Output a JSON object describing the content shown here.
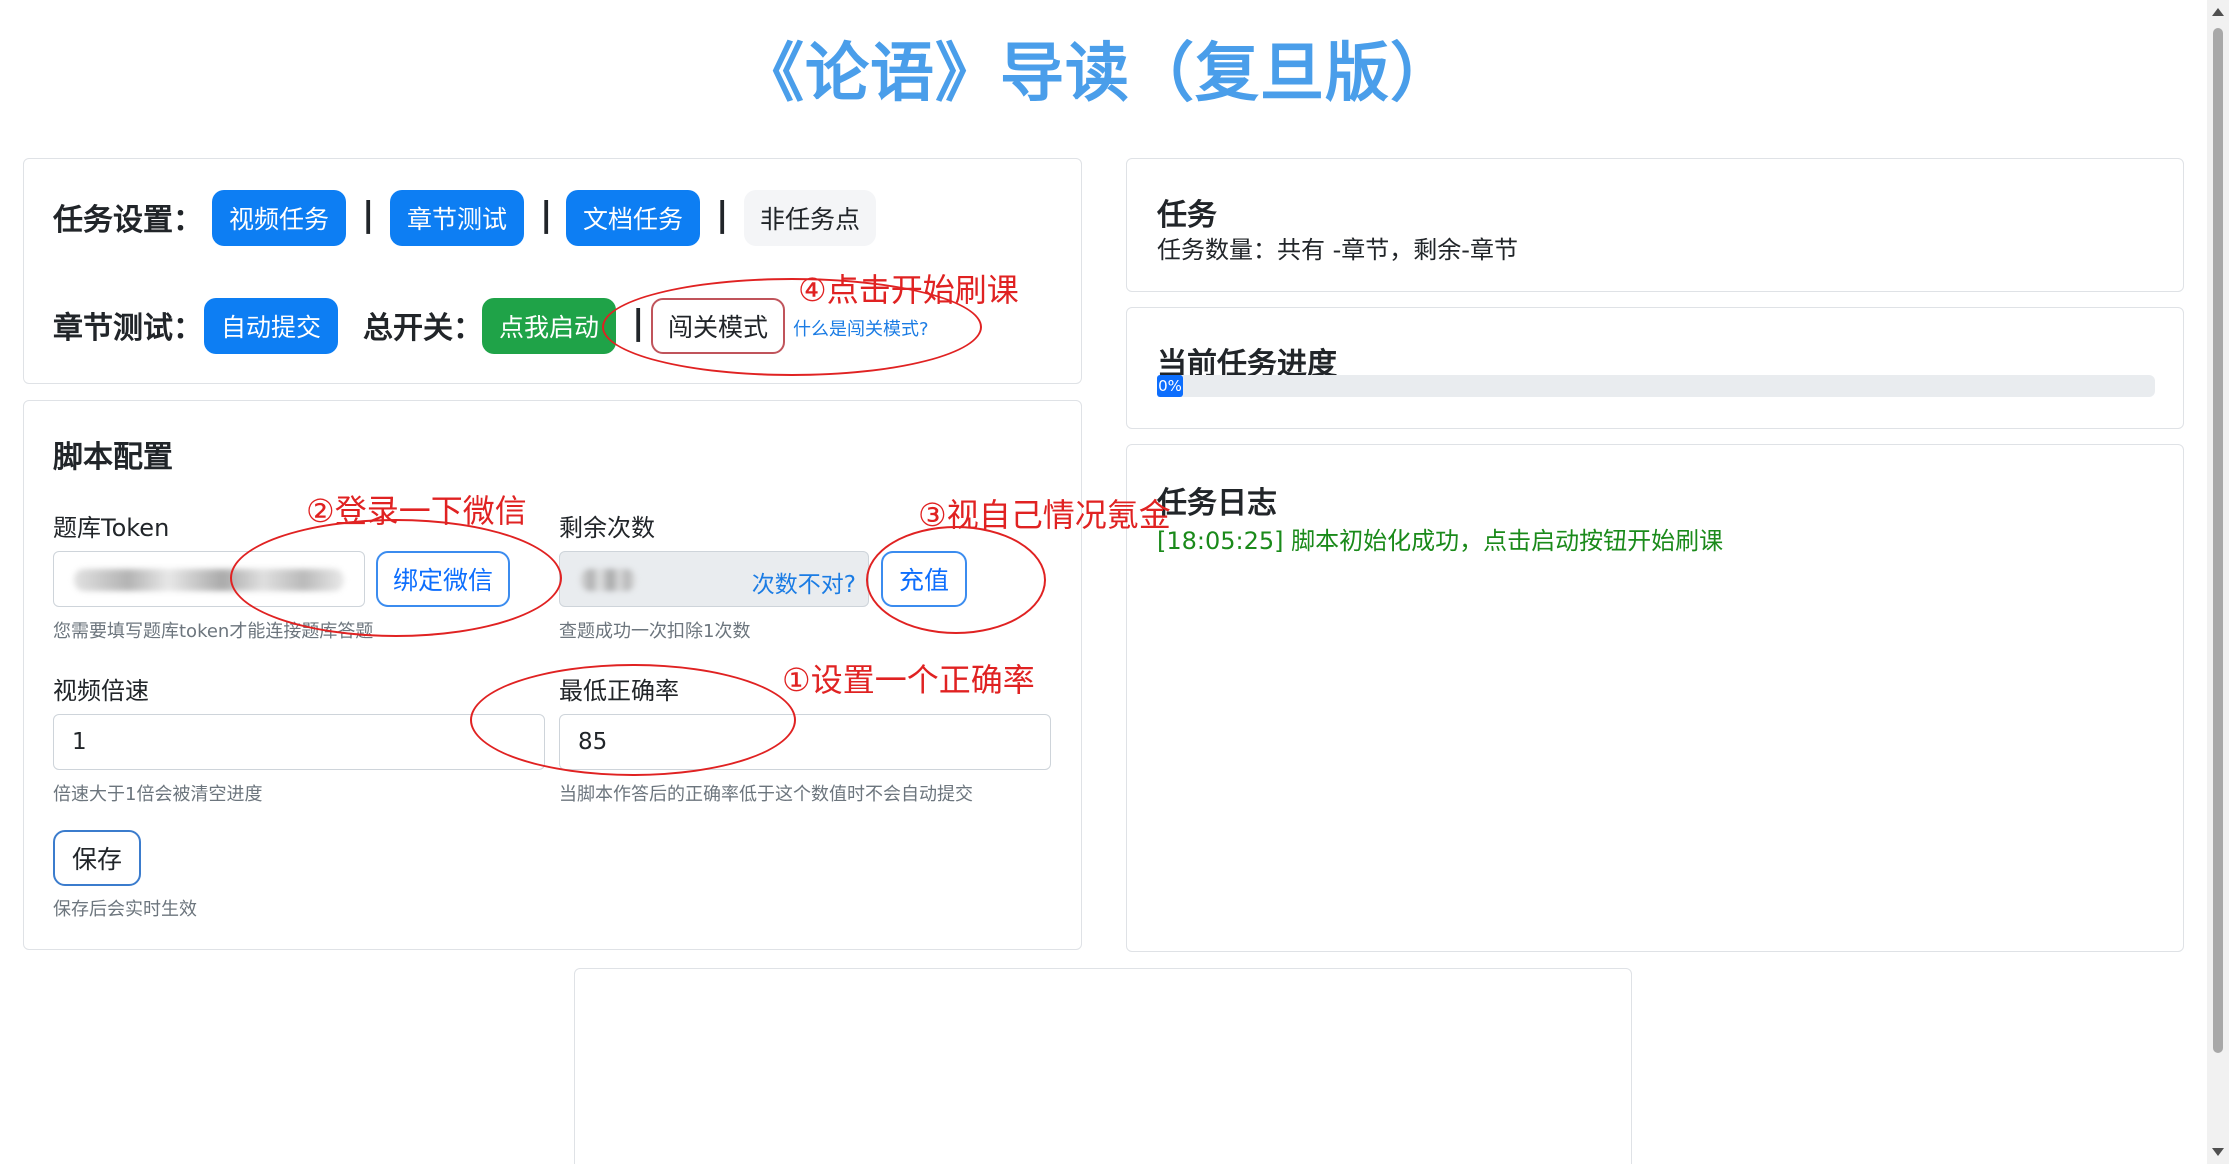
{
  "page_title": "《论语》导读（复旦版）",
  "task_settings": {
    "label": "任务设置：",
    "buttons": [
      "视频任务",
      "章节测试",
      "文档任务",
      "非任务点"
    ],
    "separator": "|"
  },
  "chapter_test": {
    "label": "章节测试：",
    "auto_submit": "自动提交",
    "master_switch_label": "总开关：",
    "start_button": "点我启动",
    "breakthrough_mode": "闯关模式",
    "what_is_link": "什么是闯关模式?"
  },
  "script_config": {
    "heading": "脚本配置",
    "token_label": "题库Token",
    "bind_wechat": "绑定微信",
    "token_help": "您需要填写题库token才能连接题库答题",
    "remaining_label": "剩余次数",
    "remaining_link": "次数不对?",
    "recharge": "充值",
    "remaining_help": "查题成功一次扣除1次数",
    "speed_label": "视频倍速",
    "speed_value": "1",
    "speed_help": "倍速大于1倍会被清空进度",
    "accuracy_label": "最低正确率",
    "accuracy_value": "85",
    "accuracy_help": "当脚本作答后的正确率低于这个数值时不会自动提交",
    "save": "保存",
    "save_help": "保存后会实时生效"
  },
  "task_panel": {
    "heading": "任务",
    "count_text": "任务数量：共有 -章节，剩余-章节"
  },
  "progress_panel": {
    "heading": "当前任务进度",
    "percent_label": "0%",
    "percent": 0
  },
  "log_panel": {
    "heading": "任务日志",
    "entries": [
      "[18:05:25] 脚本初始化成功，点击启动按钮开始刷课"
    ]
  },
  "annotations": {
    "step1": "①设置一个正确率",
    "step2": "②登录一下微信",
    "step3": "③视自己情况氪金",
    "step4": "④点击开始刷课"
  },
  "colors": {
    "primary": "#0d7ef3",
    "success": "#1fa348",
    "title": "#4a9eea",
    "annotation": "#e02222",
    "log_text": "#1a8a1a"
  }
}
